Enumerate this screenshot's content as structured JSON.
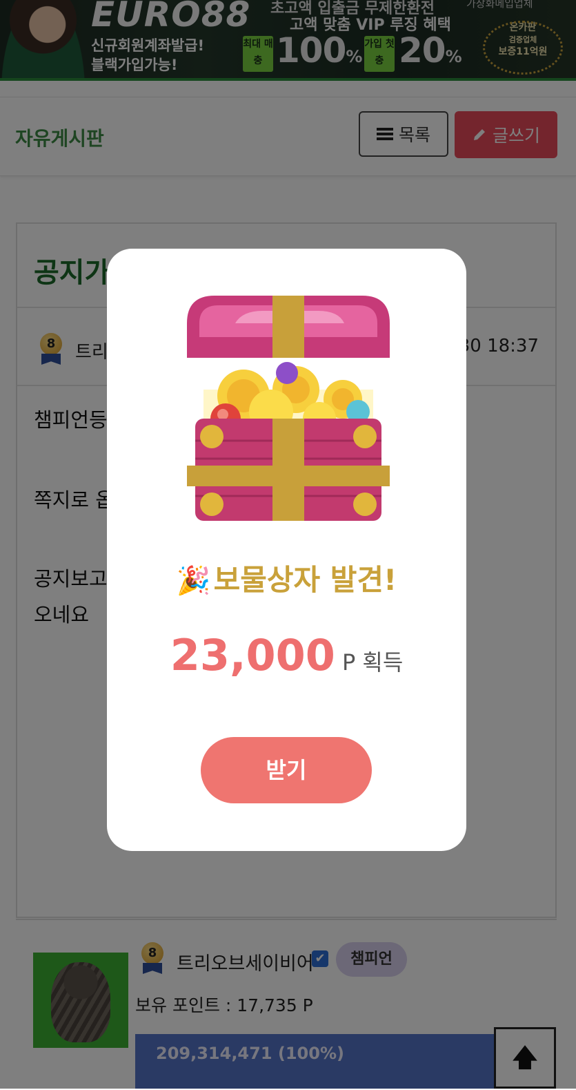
{
  "banner": {
    "logo": "EURO88",
    "top_text": "초고액 입출금 무제한환전",
    "vip_text": "고액 맞춤 VIP 루징 혜택",
    "sub1": "신규회원계좌발급!",
    "sub2": "블랙가입가능!",
    "badge1": "최대 매충",
    "big1": "100",
    "badge2": "가입 첫충",
    "big2": "20",
    "percent": "%",
    "corner_text": "가장화메입업체",
    "seal_line1": "온카판",
    "seal_line2": "검증업체",
    "seal_line3": "보증11억원"
  },
  "header": {
    "title": "자유게시판",
    "list_button": "목록",
    "write_button": "글쓰기"
  },
  "notice": {
    "title": "공지가",
    "medal_level": "8",
    "author": "트리",
    "date": "30 18:37",
    "body_lines": [
      "챔피언등",
      "",
      "쪽지로 옵",
      "",
      "",
      "공지보고",
      "오네요"
    ]
  },
  "profile": {
    "medal_level": "8",
    "name": "트리오브세이비어",
    "check": "✔",
    "rank": "챔피언",
    "points": "보유 포인트 : 17,735 P",
    "exp_text": "209,314,471 (100%)",
    "exp_percent": 100
  },
  "top_button": "🡅",
  "modal": {
    "party_emoji": "🎉",
    "title": "보물상자 발견!",
    "amount": "23,000",
    "unit": "P 획득",
    "receive_button": "받기"
  },
  "colors": {
    "accent_red": "#e94a5a",
    "board_green": "#3d8a44",
    "modal_gold": "#c9a13a",
    "amount_coral": "#ee6f6f",
    "button_coral": "#ef7570"
  }
}
